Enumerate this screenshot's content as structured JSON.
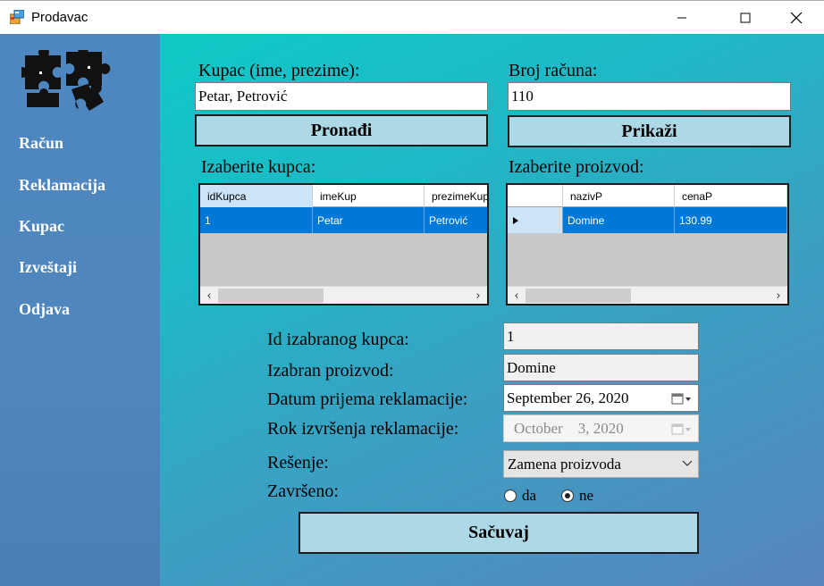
{
  "window": {
    "title": "Prodavac"
  },
  "sidebar": {
    "items": [
      {
        "label": "Račun"
      },
      {
        "label": "Reklamacija"
      },
      {
        "label": "Kupac"
      },
      {
        "label": "Izveštaji"
      },
      {
        "label": "Odjava"
      }
    ]
  },
  "search_customer": {
    "label": "Kupac (ime, prezime):",
    "value": "Petar, Petrović",
    "button": "Pronađi"
  },
  "search_invoice": {
    "label": "Broj računa:",
    "value": "110",
    "button": "Prikaži"
  },
  "customers_grid": {
    "label": "Izaberite kupca:",
    "columns": [
      "idKupca",
      "imeKup",
      "prezimeKup"
    ],
    "rows": [
      [
        "1",
        "Petar",
        "Petrović"
      ]
    ]
  },
  "products_grid": {
    "label": "Izaberite proizvod:",
    "columns": [
      "",
      "nazivP",
      "cenaP"
    ],
    "rows": [
      [
        "",
        "Domine",
        "130.99"
      ]
    ]
  },
  "form": {
    "customer_id": {
      "label": "Id izabranog kupca:",
      "value": "1"
    },
    "product": {
      "label": "Izabran proizvod:",
      "value": "Domine"
    },
    "received_date": {
      "label": "Datum prijema reklamacije:",
      "value": "September 26, 2020"
    },
    "deadline": {
      "label": "Rok izvršenja reklamacije:",
      "value": "October    3, 2020"
    },
    "resolution": {
      "label": "Rešenje:",
      "value": "Zamena proizvoda"
    },
    "completed": {
      "label": "Završeno:",
      "yes": "da",
      "no": "ne",
      "selected": "ne"
    },
    "save_button": "Sačuvaj"
  }
}
